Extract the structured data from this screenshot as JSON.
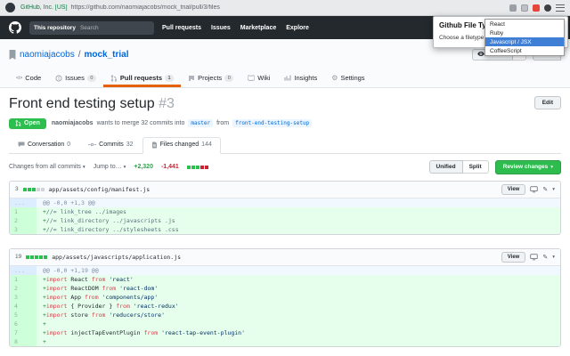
{
  "browser": {
    "security_label": "GitHub, Inc. [US]",
    "url": "https://github.com/naomiajacobs/mock_trial/pull/3/files"
  },
  "extension_popup": {
    "title": "Github File Type Filter",
    "choose_label": "Choose a filetype to show:",
    "options": [
      "React",
      "Ruby",
      "Javascript / JSX",
      "CoffeeScript"
    ],
    "selected_index": 2
  },
  "github_nav": {
    "search_scope": "This repository",
    "search_placeholder": "Search",
    "links": [
      "Pull requests",
      "Issues",
      "Marketplace",
      "Explore"
    ]
  },
  "repo": {
    "owner": "naomiajacobs",
    "separator": "/",
    "name": "mock_trial",
    "watch_label": "Watch",
    "watch_count": "0",
    "star_label": "Star"
  },
  "repo_tabs": [
    {
      "label": "Code"
    },
    {
      "label": "Issues",
      "count": "0"
    },
    {
      "label": "Pull requests",
      "count": "1"
    },
    {
      "label": "Projects",
      "count": "0"
    },
    {
      "label": "Wiki"
    },
    {
      "label": "Insights"
    },
    {
      "label": "Settings"
    }
  ],
  "pr": {
    "title": "Front end testing setup",
    "number": "#3",
    "edit_label": "Edit",
    "state_label": "Open",
    "author": "naomiajacobs",
    "action_text": "wants to merge 32 commits into",
    "base_branch": "master",
    "from_text": "from",
    "head_branch": "front-end-testing-setup"
  },
  "pr_tabs": [
    {
      "label": "Conversation",
      "count": "0"
    },
    {
      "label": "Commits",
      "count": "32"
    },
    {
      "label": "Files changed",
      "count": "144"
    }
  ],
  "diffbar": {
    "changes_dropdown": "Changes from all commits",
    "jump_dropdown": "Jump to…",
    "additions": "+2,320",
    "deletions": "-1,441",
    "blocks": [
      "g",
      "g",
      "g",
      "r",
      "r"
    ],
    "unified_label": "Unified",
    "split_label": "Split",
    "review_label": "Review changes"
  },
  "ui": {
    "view_label": "View"
  },
  "icons": {
    "caret_down": "▾",
    "star": "★",
    "gear": "⚙",
    "pencil": "✎",
    "code": "</>"
  },
  "files": [
    {
      "changes": "3",
      "blocks": [
        "g",
        "g",
        "g",
        "n",
        "n"
      ],
      "path": "app/assets/config/manifest.js",
      "lines": [
        {
          "num": "...",
          "type": "hunk",
          "segs": [
            [
              "h",
              "@@ -0,0 +1,3 @@"
            ]
          ]
        },
        {
          "num": "1",
          "type": "add",
          "segs": [
            [
              "a",
              "+"
            ],
            [
              "c",
              "//= link_tree ../images"
            ]
          ]
        },
        {
          "num": "2",
          "type": "add",
          "segs": [
            [
              "a",
              "+"
            ],
            [
              "c",
              "//= link_directory ../javascripts .js"
            ]
          ]
        },
        {
          "num": "3",
          "type": "add",
          "segs": [
            [
              "a",
              "+"
            ],
            [
              "c",
              "//= link_directory ../stylesheets .css"
            ]
          ]
        }
      ]
    },
    {
      "changes": "19",
      "blocks": [
        "g",
        "g",
        "g",
        "g",
        "g"
      ],
      "path": "app/assets/javascripts/application.js",
      "lines": [
        {
          "num": "...",
          "type": "hunk",
          "segs": [
            [
              "h",
              "@@ -0,0 +1,19 @@"
            ]
          ]
        },
        {
          "num": "1",
          "type": "add",
          "segs": [
            [
              "a",
              "+"
            ],
            [
              "k",
              "import"
            ],
            [
              "p",
              " React "
            ],
            [
              "k",
              "from"
            ],
            [
              "s",
              " 'react'"
            ]
          ]
        },
        {
          "num": "2",
          "type": "add",
          "segs": [
            [
              "a",
              "+"
            ],
            [
              "k",
              "import"
            ],
            [
              "p",
              " ReactDOM "
            ],
            [
              "k",
              "from"
            ],
            [
              "s",
              " 'react-dom'"
            ]
          ]
        },
        {
          "num": "3",
          "type": "add",
          "segs": [
            [
              "a",
              "+"
            ],
            [
              "k",
              "import"
            ],
            [
              "p",
              " App "
            ],
            [
              "k",
              "from"
            ],
            [
              "s",
              " 'components/app'"
            ]
          ]
        },
        {
          "num": "4",
          "type": "add",
          "segs": [
            [
              "a",
              "+"
            ],
            [
              "k",
              "import"
            ],
            [
              "p",
              " { Provider } "
            ],
            [
              "k",
              "from"
            ],
            [
              "s",
              " 'react-redux'"
            ]
          ]
        },
        {
          "num": "5",
          "type": "add",
          "segs": [
            [
              "a",
              "+"
            ],
            [
              "k",
              "import"
            ],
            [
              "p",
              " store "
            ],
            [
              "k",
              "from"
            ],
            [
              "s",
              " 'reducers/store'"
            ]
          ]
        },
        {
          "num": "6",
          "type": "add",
          "segs": [
            [
              "a",
              "+"
            ]
          ]
        },
        {
          "num": "7",
          "type": "add",
          "segs": [
            [
              "a",
              "+"
            ],
            [
              "k",
              "import"
            ],
            [
              "p",
              " injectTapEventPlugin "
            ],
            [
              "k",
              "from"
            ],
            [
              "s",
              " 'react-tap-event-plugin'"
            ]
          ]
        },
        {
          "num": "8",
          "type": "add",
          "segs": [
            [
              "a",
              "+"
            ]
          ]
        }
      ]
    }
  ]
}
